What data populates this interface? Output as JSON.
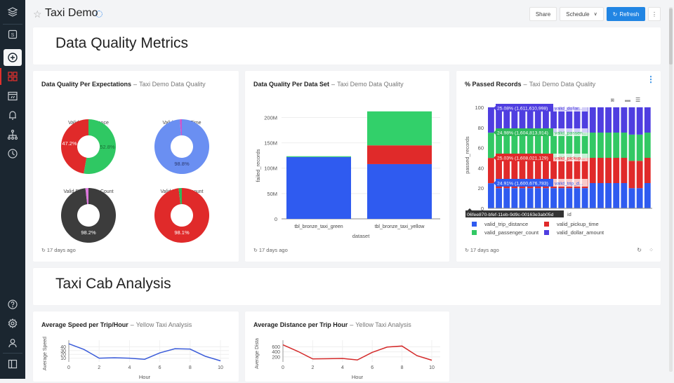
{
  "header": {
    "title": "Taxi Demo",
    "share_label": "Share",
    "schedule_label": "Schedule",
    "refresh_label": "Refresh",
    "refresh_icon": "refresh-icon",
    "more_icon": "kebab-icon"
  },
  "sidebar": {
    "items": [
      {
        "name": "layers-icon"
      },
      {
        "name": "sql-icon",
        "label": "S"
      },
      {
        "name": "add-icon"
      },
      {
        "name": "dashboards-icon"
      },
      {
        "name": "queries-icon"
      },
      {
        "name": "alerts-icon"
      },
      {
        "name": "workflows-icon"
      },
      {
        "name": "history-icon"
      }
    ],
    "bottom": [
      {
        "name": "help-icon"
      },
      {
        "name": "settings-icon"
      },
      {
        "name": "user-icon"
      },
      {
        "name": "collapse-sidebar-icon"
      }
    ]
  },
  "sections": [
    {
      "title": "Data Quality Metrics"
    },
    {
      "title": "Taxi Cab Analysis"
    }
  ],
  "widgets": [
    {
      "title": "Data Quality Per Expectations",
      "source": "Taxi Demo Data Quality",
      "updated": "17 days ago"
    },
    {
      "title": "Data Quality Per Data Set",
      "source": "Taxi Demo Data Quality",
      "updated": "17 days ago"
    },
    {
      "title": "% Passed Records",
      "source": "Taxi Demo Data Quality",
      "updated": "17 days ago"
    },
    {
      "title": "Average Speed per Trip/Hour",
      "source": "Yellow Taxi Analysis"
    },
    {
      "title": "Average Distance per Trip Hour",
      "source": "Yellow Taxi Analysis"
    }
  ],
  "chart_data": [
    {
      "type": "pie",
      "title": "Data Quality Per Expectations",
      "donuts": [
        {
          "title": "Valid Trip Distance",
          "slices": [
            {
              "label": "passed",
              "value": 52.8,
              "color": "#2fc863"
            },
            {
              "label": "failed",
              "value": 47.2,
              "color": "#e02a2a"
            }
          ],
          "labels": [
            "52.8%",
            "47.2%"
          ]
        },
        {
          "title": "Valid Pickup Time",
          "slices": [
            {
              "label": "passed",
              "value": 98.8,
              "color": "#6a8ff2"
            },
            {
              "label": "failed",
              "value": 1.2,
              "color": "#cc55cc"
            }
          ],
          "labels": [
            "98.8%"
          ]
        },
        {
          "title": "Valid Passenger Count",
          "slices": [
            {
              "label": "passed",
              "value": 98.2,
              "color": "#3c3c3c"
            },
            {
              "label": "failed",
              "value": 1.8,
              "color": "#dd77dd"
            }
          ],
          "labels": [
            "98.2%"
          ]
        },
        {
          "title": "Valid Dollar Amount",
          "slices": [
            {
              "label": "passed",
              "value": 98.1,
              "color": "#e02a2a"
            },
            {
              "label": "failed",
              "value": 1.9,
              "color": "#2fb85a"
            }
          ],
          "labels": [
            "98.1%"
          ]
        }
      ]
    },
    {
      "type": "bar",
      "title": "Data Quality Per Data Set",
      "categories": [
        "tbl_bronze_taxi_green",
        "tbl_bronze_taxi_yellow"
      ],
      "series": [
        {
          "name": "blue",
          "color": "#2f5bf0",
          "values": [
            122,
            108
          ]
        },
        {
          "name": "red",
          "color": "#e02a2a",
          "values": [
            0,
            37
          ]
        },
        {
          "name": "green",
          "color": "#32d06a",
          "values": [
            1.5,
            67
          ]
        }
      ],
      "xlabel": "dataset",
      "ylabel": "failed_records",
      "yticks": [
        "0",
        "50M",
        "100M",
        "150M",
        "200M"
      ],
      "ylim": [
        0,
        220
      ],
      "unit": "M"
    },
    {
      "type": "bar",
      "title": "% Passed Records",
      "stacked": true,
      "bar_count": 21,
      "xlabel": "id",
      "ylabel": "passed_records",
      "yticks": [
        "0",
        "20",
        "40",
        "60",
        "80",
        "100"
      ],
      "ylim": [
        0,
        100
      ],
      "series": [
        {
          "name": "valid_trip_distance",
          "color": "#2f5bf0",
          "values": [
            24.9,
            20,
            20,
            20,
            20,
            20,
            20,
            20,
            20,
            20,
            20,
            20,
            20,
            25,
            25,
            25,
            25,
            25,
            20,
            20,
            25
          ]
        },
        {
          "name": "valid_pickup_time",
          "color": "#e02a2a",
          "values": [
            25.0,
            30,
            30,
            30,
            30,
            30,
            30,
            30,
            30,
            30,
            30,
            30,
            30,
            25,
            25,
            25,
            25,
            25,
            27,
            27,
            25
          ]
        },
        {
          "name": "valid_passenger_count",
          "color": "#32c864",
          "values": [
            25.0,
            25,
            25,
            25,
            25,
            25,
            25,
            25,
            25,
            25,
            25,
            25,
            25,
            25,
            25,
            25,
            25,
            25,
            26,
            26,
            25
          ]
        },
        {
          "name": "valid_dollar_amount",
          "color": "#4f3ee0",
          "values": [
            25.1,
            25,
            25,
            25,
            25,
            25,
            25,
            25,
            25,
            25,
            25,
            25,
            25,
            25,
            25,
            25,
            25,
            25,
            27,
            27,
            25
          ]
        }
      ],
      "hover_labels": [
        {
          "text": "25.08% (1,611,610,998)",
          "series": "valid_dollar...",
          "color": "#4f3ee0"
        },
        {
          "text": "24.98% (1,604,813,914)",
          "series": "valid_passen...",
          "color": "#2fb85a"
        },
        {
          "text": "25.03% (1,608,021,129)",
          "series": "valid_pickup...",
          "color": "#e02a2a"
        },
        {
          "text": "24.91% (1,600,676,783)",
          "series": "valid_trip_d...",
          "color": "#2f5bf0"
        }
      ],
      "x_hover": "06fee870-bfef-11eb-9d9c-00163e3ab05d",
      "legend": [
        "valid_trip_distance",
        "valid_pickup_time",
        "valid_passenger_count",
        "valid_dollar_amount"
      ]
    },
    {
      "type": "line",
      "title": "Average Speed per Trip/Hour",
      "x": [
        0,
        1,
        2,
        3,
        4,
        5,
        6,
        7,
        8,
        9,
        10
      ],
      "values": [
        48,
        33,
        10,
        11,
        10,
        7,
        24,
        35,
        34,
        15,
        3
      ],
      "color": "#3a5bd9",
      "xlabel": "Hour",
      "ylabel": "Average Speed",
      "yticks": [
        "10",
        "20",
        "30",
        "40"
      ],
      "ylim": [
        0,
        50
      ],
      "xticks": [
        "0",
        "2",
        "4",
        "6",
        "8",
        "10"
      ]
    },
    {
      "type": "line",
      "title": "Average Distance per Trip Hour",
      "x": [
        0,
        1,
        2,
        3,
        4,
        5,
        6,
        7,
        8,
        9,
        10
      ],
      "values": [
        680,
        420,
        120,
        130,
        140,
        80,
        380,
        590,
        630,
        250,
        70
      ],
      "color": "#d42a2a",
      "xlabel": "Hour",
      "ylabel": "Average Distance",
      "yticks": [
        "200",
        "400",
        "600"
      ],
      "ylim": [
        0,
        750
      ],
      "xticks": [
        "0",
        "2",
        "4",
        "6",
        "8",
        "10"
      ]
    }
  ]
}
